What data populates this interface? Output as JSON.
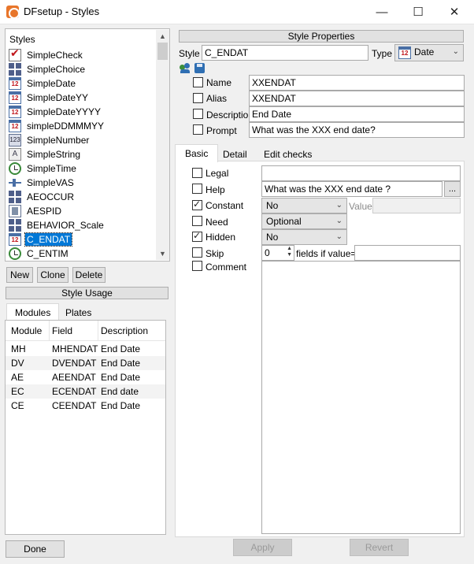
{
  "window": {
    "title": "DFsetup - Styles",
    "minimize": "—",
    "maximize": "☐",
    "close": "✕"
  },
  "styles": {
    "header": "Styles",
    "items": [
      {
        "label": "SimpleCheck",
        "icon": "check-icon"
      },
      {
        "label": "SimpleChoice",
        "icon": "choice-grid-icon"
      },
      {
        "label": "SimpleDate",
        "icon": "calendar-icon"
      },
      {
        "label": "SimpleDateYY",
        "icon": "calendar-icon"
      },
      {
        "label": "SimpleDateYYYY",
        "icon": "calendar-icon"
      },
      {
        "label": "simpleDDMMMYY",
        "icon": "calendar-icon"
      },
      {
        "label": "SimpleNumber",
        "icon": "number-icon"
      },
      {
        "label": "SimpleString",
        "icon": "string-icon"
      },
      {
        "label": "SimpleTime",
        "icon": "clock-icon"
      },
      {
        "label": "SimpleVAS",
        "icon": "vas-icon"
      },
      {
        "label": "AEOCCUR",
        "icon": "choice-grid-icon"
      },
      {
        "label": "AESPID",
        "icon": "pid-icon"
      },
      {
        "label": "BEHAVIOR_Scale",
        "icon": "choice-grid-icon"
      },
      {
        "label": "C_ENDAT",
        "icon": "calendar-icon"
      },
      {
        "label": "C_ENTIM",
        "icon": "clock-icon"
      }
    ],
    "selected": "C_ENDAT",
    "new_label": "New",
    "clone_label": "Clone",
    "delete_label": "Delete"
  },
  "usage": {
    "header": "Style Usage",
    "tabs": [
      "Modules",
      "Plates"
    ],
    "active_tab": "Modules",
    "columns": [
      "Module",
      "Field",
      "Description"
    ],
    "rows": [
      [
        "MH",
        "MHENDAT",
        "End Date"
      ],
      [
        "DV",
        "DVENDAT",
        "End Date"
      ],
      [
        "AE",
        "AEENDAT",
        "End Date"
      ],
      [
        "EC",
        "ECENDAT",
        "End date"
      ],
      [
        "CE",
        "CEENDAT",
        "End Date"
      ]
    ]
  },
  "props": {
    "header": "Style Properties",
    "style_label": "Style",
    "style_value": "C_ENDAT",
    "type_label": "Type",
    "type_value": "Date",
    "name_label": "Name",
    "name_value": "XXENDAT",
    "alias_label": "Alias",
    "alias_value": "XXENDAT",
    "description_label": "Description",
    "description_value": "End Date",
    "prompt_label": "Prompt",
    "prompt_value": "What was the XXX end date?"
  },
  "detail": {
    "tabs": [
      "Basic",
      "Detail",
      "Edit checks"
    ],
    "active_tab": "Basic",
    "legal_label": "Legal",
    "legal_value": "",
    "help_label": "Help",
    "help_value": "What was the XXX end date ?",
    "help_browse": "...",
    "constant_label": "Constant",
    "constant_checked": true,
    "constant_value": "No",
    "value_label": "Value",
    "need_label": "Need",
    "need_value": "Optional",
    "hidden_label": "Hidden",
    "hidden_checked": true,
    "hidden_value": "No",
    "skip_label": "Skip",
    "skip_value": "0",
    "skip_suffix": "fields if value=",
    "comment_label": "Comment"
  },
  "footer": {
    "done_label": "Done",
    "apply_label": "Apply",
    "revert_label": "Revert"
  },
  "colors": {
    "selection": "#0078d7",
    "app_icon": "#e8762b"
  }
}
